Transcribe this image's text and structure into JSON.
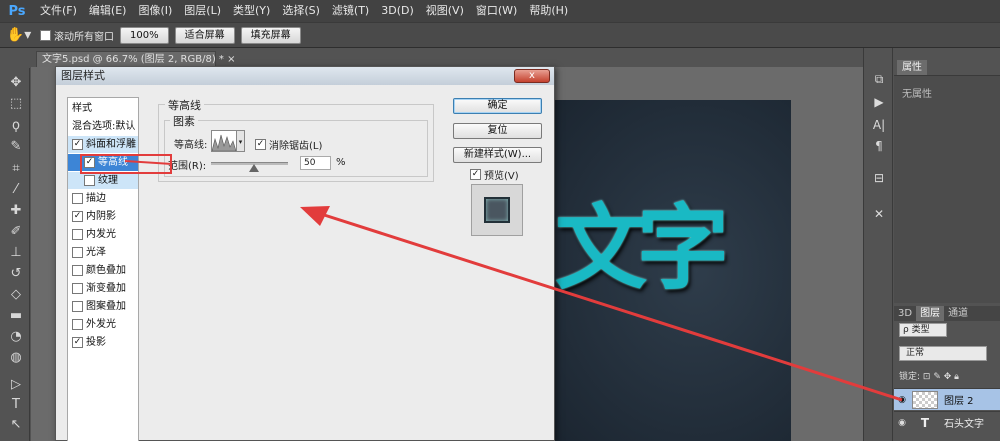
{
  "app": {
    "logo": "Ps"
  },
  "menu": [
    "文件(F)",
    "编辑(E)",
    "图像(I)",
    "图层(L)",
    "类型(Y)",
    "选择(S)",
    "滤镜(T)",
    "3D(D)",
    "视图(V)",
    "窗口(W)",
    "帮助(H)"
  ],
  "options_bar": {
    "scroll_all_label": "滚动所有窗口",
    "zoom_100": "100%",
    "fit_screen": "适合屏幕",
    "fill_screen": "填充屏幕"
  },
  "document_tab": {
    "title": "文字5.psd @ 66.7% (图层 2, RGB/8) *",
    "close": "×"
  },
  "canvas": {
    "text": "文字"
  },
  "dialog": {
    "title": "图层样式",
    "close": "x",
    "style_list": [
      {
        "label": "样式",
        "checked": null
      },
      {
        "label": "混合选项:默认",
        "checked": null
      },
      {
        "label": "斜面和浮雕",
        "checked": true
      },
      {
        "label": "等高线",
        "checked": true
      },
      {
        "label": "纹理",
        "checked": false
      },
      {
        "label": "描边",
        "checked": false
      },
      {
        "label": "内阴影",
        "checked": true
      },
      {
        "label": "内发光",
        "checked": false
      },
      {
        "label": "光泽",
        "checked": false
      },
      {
        "label": "颜色叠加",
        "checked": false
      },
      {
        "label": "渐变叠加",
        "checked": false
      },
      {
        "label": "图案叠加",
        "checked": false
      },
      {
        "label": "外发光",
        "checked": false
      },
      {
        "label": "投影",
        "checked": true
      }
    ],
    "group_title": "等高线",
    "subgroup_title": "图素",
    "contour_label": "等高线:",
    "antialias_label": "消除锯齿(L)",
    "range_label": "范围(R):",
    "range_value": "50",
    "range_unit": "%",
    "range_fraction": 0.5,
    "buttons": {
      "ok": "确定",
      "reset": "复位",
      "new_style": "新建样式(W)...",
      "preview": "预览(V)"
    }
  },
  "properties_panel": {
    "tab": "属性",
    "empty_text": "无属性"
  },
  "layers_panel": {
    "tabs": [
      "3D",
      "图层",
      "通道"
    ],
    "filter": "ρ 类型",
    "blend_mode": "正常",
    "lock_label": "锁定:",
    "layers": [
      {
        "name": "图层 2",
        "type": "pixel",
        "selected": true
      },
      {
        "name": "石头文字",
        "type": "text",
        "selected": false
      }
    ]
  },
  "colors": {
    "highlight": "#e23c3c",
    "text_cyan": "#19b9c4",
    "selection": "#3d85d6"
  }
}
